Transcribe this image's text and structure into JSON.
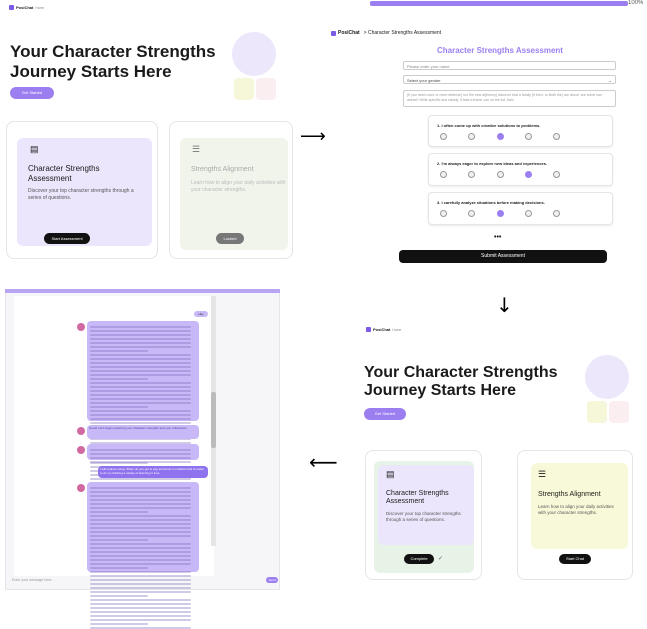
{
  "brand": {
    "name": "PosiChat",
    "sub": "Home",
    "accent": "#9b7ff0"
  },
  "panel1": {
    "hero_line1": "Your Character Strengths",
    "hero_line2": "Journey Starts Here",
    "get_started": "Get Started",
    "card1": {
      "title": "Character Strengths Assessment",
      "desc": "Discover your top character strengths through a series of questions.",
      "button": "Start Assessment"
    },
    "card2": {
      "title": "Strengths Alignment",
      "desc": "Learn how to align your daily activities with your character strengths.",
      "button": "Locked"
    }
  },
  "panel2": {
    "progress": "100%",
    "breadcrumb_brand": "PosiChat",
    "breadcrumb_page": "> Character Strengths Assessment",
    "title": "Character Strengths Assessment",
    "name_placeholder": "Please enter your name",
    "gender_placeholder": "Select your gender",
    "textarea_text": "(If you need more or more defense) nor the new ai(theory) discover that a family (If then, or Both the) are about, are some can ahead? Write specific and clearly. If take a frame can on the list, train",
    "questions": [
      {
        "text": "1. I often come up with creative solutions to problems.",
        "options": [
          "1",
          "2",
          "3",
          "4",
          "5"
        ],
        "selected": 2
      },
      {
        "text": "2. I'm always eager to explore new ideas and experiences.",
        "options": [
          "1",
          "2",
          "3",
          "4",
          "5"
        ],
        "selected": 3
      },
      {
        "text": "3. I carefully analyze situations before making decisions.",
        "options": [
          "1",
          "2",
          "3",
          "4",
          "5"
        ],
        "selected": 2
      }
    ],
    "more": "•••",
    "submit": "Submit Assessment"
  },
  "panel3": {
    "input_placeholder": "Enter your message here...",
    "send": "Send",
    "user_msgs": [
      "Hey",
      "I will explore using. When do you get to pay tomorrow in creative kind of prefer to do my thinking a variety of learning in time"
    ],
    "mid_note": "Great! Let's begin exploring your character strengths and your reflections!"
  },
  "panel4": {
    "hero_line1": "Your Character Strengths",
    "hero_line2": "Journey Starts Here",
    "get_started": "Get Started",
    "card1": {
      "title": "Character Strengths Assessment",
      "desc": "Discover your top character strengths through a series of questions.",
      "button": "Complete",
      "check": "✓"
    },
    "card2": {
      "title": "Strengths Alignment",
      "desc": "Learn how to align your daily activities with your character strengths.",
      "button": "Start Chat"
    }
  },
  "icons": {
    "arrow_right": "⟶",
    "arrow_down": "↓",
    "arrow_left": "⟵"
  }
}
